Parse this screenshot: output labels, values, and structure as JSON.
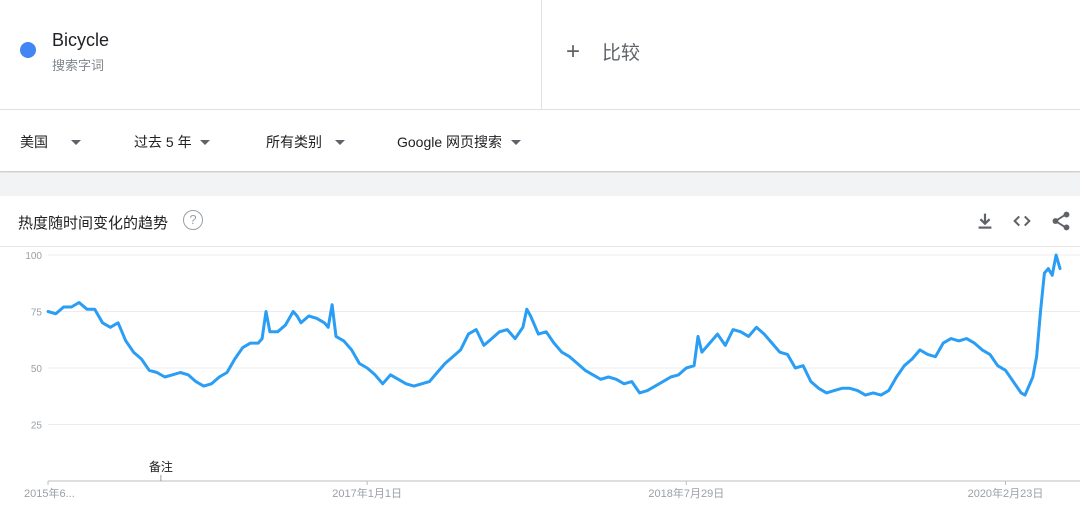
{
  "term": {
    "name": "Bicycle",
    "type": "搜索字词",
    "color": "#4285f4"
  },
  "compare": {
    "icon": "plus-icon",
    "label": "比较"
  },
  "filters": [
    {
      "label": "美国"
    },
    {
      "label": "过去 5 年"
    },
    {
      "label": "所有类别"
    },
    {
      "label": "Google 网页搜索"
    }
  ],
  "card": {
    "title": "热度随时间变化的趋势",
    "help_icon": "?",
    "actions": [
      "download-icon",
      "embed-icon",
      "share-icon"
    ]
  },
  "chart_data": {
    "type": "line",
    "title": "",
    "xlabel": "",
    "ylabel": "",
    "ylim": [
      0,
      100
    ],
    "xlim": [
      "2015-06-07",
      "2020-05-31"
    ],
    "yticks": [
      25,
      50,
      75,
      100
    ],
    "xtick_labels": [
      {
        "label": "2015年6...",
        "x": "2015-06-07"
      },
      {
        "label": "2017年1月1日",
        "x": "2017-01-01"
      },
      {
        "label": "2018年7月29日",
        "x": "2018-07-29"
      },
      {
        "label": "2020年2月23日",
        "x": "2020-02-23"
      }
    ],
    "grid": true,
    "legend": "none",
    "annotations": [
      {
        "text": "备注",
        "x": "2015-12-27"
      }
    ],
    "series": [
      {
        "color": "#2a9df4",
        "points": [
          {
            "x": "2015-06-07",
            "y": 75
          },
          {
            "x": "2015-06-21",
            "y": 74
          },
          {
            "x": "2015-07-05",
            "y": 77
          },
          {
            "x": "2015-07-19",
            "y": 77
          },
          {
            "x": "2015-08-02",
            "y": 79
          },
          {
            "x": "2015-08-16",
            "y": 76
          },
          {
            "x": "2015-08-30",
            "y": 76
          },
          {
            "x": "2015-09-13",
            "y": 70
          },
          {
            "x": "2015-09-27",
            "y": 68
          },
          {
            "x": "2015-10-11",
            "y": 70
          },
          {
            "x": "2015-10-25",
            "y": 62
          },
          {
            "x": "2015-11-08",
            "y": 57
          },
          {
            "x": "2015-11-22",
            "y": 54
          },
          {
            "x": "2015-12-06",
            "y": 49
          },
          {
            "x": "2015-12-20",
            "y": 48
          },
          {
            "x": "2016-01-03",
            "y": 46
          },
          {
            "x": "2016-01-17",
            "y": 47
          },
          {
            "x": "2016-01-31",
            "y": 48
          },
          {
            "x": "2016-02-14",
            "y": 47
          },
          {
            "x": "2016-02-28",
            "y": 44
          },
          {
            "x": "2016-03-13",
            "y": 42
          },
          {
            "x": "2016-03-27",
            "y": 43
          },
          {
            "x": "2016-04-10",
            "y": 46
          },
          {
            "x": "2016-04-24",
            "y": 48
          },
          {
            "x": "2016-05-08",
            "y": 54
          },
          {
            "x": "2016-05-22",
            "y": 59
          },
          {
            "x": "2016-06-05",
            "y": 61
          },
          {
            "x": "2016-06-19",
            "y": 61
          },
          {
            "x": "2016-06-26",
            "y": 63
          },
          {
            "x": "2016-07-03",
            "y": 75
          },
          {
            "x": "2016-07-10",
            "y": 66
          },
          {
            "x": "2016-07-24",
            "y": 66
          },
          {
            "x": "2016-08-07",
            "y": 69
          },
          {
            "x": "2016-08-21",
            "y": 75
          },
          {
            "x": "2016-08-28",
            "y": 73
          },
          {
            "x": "2016-09-04",
            "y": 70
          },
          {
            "x": "2016-09-18",
            "y": 73
          },
          {
            "x": "2016-10-02",
            "y": 72
          },
          {
            "x": "2016-10-16",
            "y": 70
          },
          {
            "x": "2016-10-23",
            "y": 68
          },
          {
            "x": "2016-10-30",
            "y": 78
          },
          {
            "x": "2016-11-06",
            "y": 64
          },
          {
            "x": "2016-11-20",
            "y": 62
          },
          {
            "x": "2016-12-04",
            "y": 58
          },
          {
            "x": "2016-12-18",
            "y": 52
          },
          {
            "x": "2017-01-01",
            "y": 50
          },
          {
            "x": "2017-01-15",
            "y": 47
          },
          {
            "x": "2017-01-29",
            "y": 43
          },
          {
            "x": "2017-02-12",
            "y": 47
          },
          {
            "x": "2017-02-26",
            "y": 45
          },
          {
            "x": "2017-03-12",
            "y": 43
          },
          {
            "x": "2017-03-26",
            "y": 42
          },
          {
            "x": "2017-04-09",
            "y": 43
          },
          {
            "x": "2017-04-23",
            "y": 44
          },
          {
            "x": "2017-05-07",
            "y": 48
          },
          {
            "x": "2017-05-21",
            "y": 52
          },
          {
            "x": "2017-06-04",
            "y": 55
          },
          {
            "x": "2017-06-18",
            "y": 58
          },
          {
            "x": "2017-07-02",
            "y": 65
          },
          {
            "x": "2017-07-16",
            "y": 67
          },
          {
            "x": "2017-07-30",
            "y": 60
          },
          {
            "x": "2017-08-13",
            "y": 63
          },
          {
            "x": "2017-08-27",
            "y": 66
          },
          {
            "x": "2017-09-10",
            "y": 67
          },
          {
            "x": "2017-09-24",
            "y": 63
          },
          {
            "x": "2017-10-08",
            "y": 68
          },
          {
            "x": "2017-10-15",
            "y": 76
          },
          {
            "x": "2017-10-22",
            "y": 73
          },
          {
            "x": "2017-11-05",
            "y": 65
          },
          {
            "x": "2017-11-19",
            "y": 66
          },
          {
            "x": "2017-12-03",
            "y": 61
          },
          {
            "x": "2017-12-17",
            "y": 57
          },
          {
            "x": "2017-12-31",
            "y": 55
          },
          {
            "x": "2018-01-14",
            "y": 52
          },
          {
            "x": "2018-01-28",
            "y": 49
          },
          {
            "x": "2018-02-11",
            "y": 47
          },
          {
            "x": "2018-02-25",
            "y": 45
          },
          {
            "x": "2018-03-11",
            "y": 46
          },
          {
            "x": "2018-03-25",
            "y": 45
          },
          {
            "x": "2018-04-08",
            "y": 43
          },
          {
            "x": "2018-04-22",
            "y": 44
          },
          {
            "x": "2018-05-06",
            "y": 39
          },
          {
            "x": "2018-05-20",
            "y": 40
          },
          {
            "x": "2018-06-03",
            "y": 42
          },
          {
            "x": "2018-06-17",
            "y": 44
          },
          {
            "x": "2018-07-01",
            "y": 46
          },
          {
            "x": "2018-07-15",
            "y": 47
          },
          {
            "x": "2018-07-29",
            "y": 50
          },
          {
            "x": "2018-08-12",
            "y": 51
          },
          {
            "x": "2018-08-19",
            "y": 64
          },
          {
            "x": "2018-08-26",
            "y": 57
          },
          {
            "x": "2018-09-09",
            "y": 61
          },
          {
            "x": "2018-09-23",
            "y": 65
          },
          {
            "x": "2018-10-07",
            "y": 60
          },
          {
            "x": "2018-10-21",
            "y": 67
          },
          {
            "x": "2018-11-04",
            "y": 66
          },
          {
            "x": "2018-11-18",
            "y": 64
          },
          {
            "x": "2018-12-02",
            "y": 68
          },
          {
            "x": "2018-12-16",
            "y": 65
          },
          {
            "x": "2018-12-30",
            "y": 61
          },
          {
            "x": "2019-01-13",
            "y": 57
          },
          {
            "x": "2019-01-27",
            "y": 56
          },
          {
            "x": "2019-02-10",
            "y": 50
          },
          {
            "x": "2019-02-24",
            "y": 51
          },
          {
            "x": "2019-03-10",
            "y": 44
          },
          {
            "x": "2019-03-24",
            "y": 41
          },
          {
            "x": "2019-04-07",
            "y": 39
          },
          {
            "x": "2019-04-21",
            "y": 40
          },
          {
            "x": "2019-05-05",
            "y": 41
          },
          {
            "x": "2019-05-19",
            "y": 41
          },
          {
            "x": "2019-06-02",
            "y": 40
          },
          {
            "x": "2019-06-16",
            "y": 38
          },
          {
            "x": "2019-06-30",
            "y": 39
          },
          {
            "x": "2019-07-14",
            "y": 38
          },
          {
            "x": "2019-07-28",
            "y": 40
          },
          {
            "x": "2019-08-11",
            "y": 46
          },
          {
            "x": "2019-08-25",
            "y": 51
          },
          {
            "x": "2019-09-08",
            "y": 54
          },
          {
            "x": "2019-09-22",
            "y": 58
          },
          {
            "x": "2019-10-06",
            "y": 56
          },
          {
            "x": "2019-10-20",
            "y": 55
          },
          {
            "x": "2019-11-03",
            "y": 61
          },
          {
            "x": "2019-11-17",
            "y": 63
          },
          {
            "x": "2019-12-01",
            "y": 62
          },
          {
            "x": "2019-12-15",
            "y": 63
          },
          {
            "x": "2019-12-29",
            "y": 61
          },
          {
            "x": "2020-01-12",
            "y": 58
          },
          {
            "x": "2020-01-26",
            "y": 56
          },
          {
            "x": "2020-02-09",
            "y": 51
          },
          {
            "x": "2020-02-23",
            "y": 49
          },
          {
            "x": "2020-03-08",
            "y": 44
          },
          {
            "x": "2020-03-22",
            "y": 39
          },
          {
            "x": "2020-03-29",
            "y": 38
          },
          {
            "x": "2020-04-05",
            "y": 42
          },
          {
            "x": "2020-04-12",
            "y": 46
          },
          {
            "x": "2020-04-19",
            "y": 55
          },
          {
            "x": "2020-04-26",
            "y": 75
          },
          {
            "x": "2020-05-03",
            "y": 92
          },
          {
            "x": "2020-05-10",
            "y": 94
          },
          {
            "x": "2020-05-17",
            "y": 91
          },
          {
            "x": "2020-05-24",
            "y": 100
          },
          {
            "x": "2020-05-31",
            "y": 94
          }
        ]
      }
    ]
  }
}
